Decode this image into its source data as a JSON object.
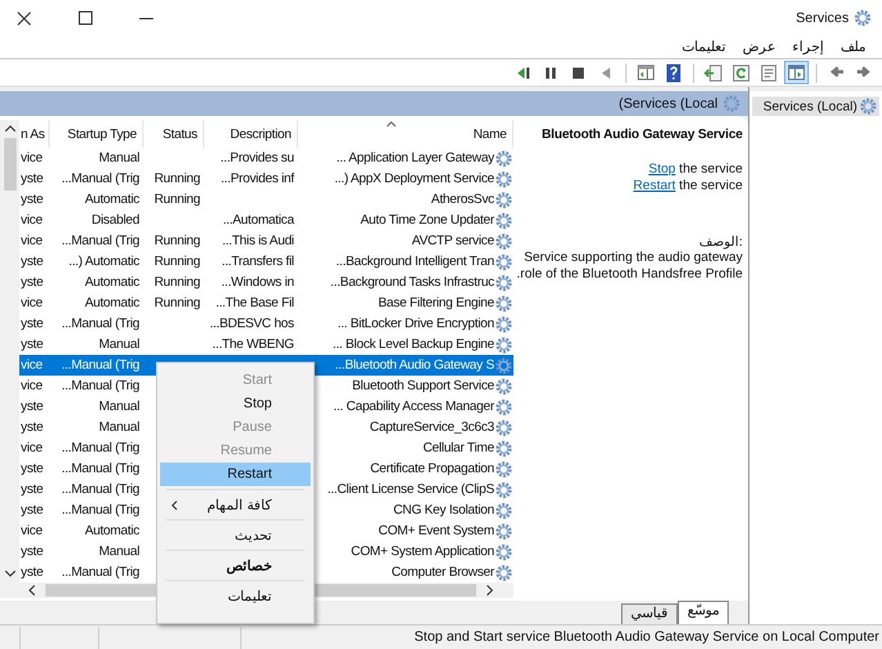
{
  "window": {
    "title": "Services"
  },
  "menu_bar": [
    {
      "label": "ملف"
    },
    {
      "label": "إجراء"
    },
    {
      "label": "عرض"
    },
    {
      "label": "تعليمات"
    }
  ],
  "toolbar": [
    {
      "kind": "forward",
      "pressed": false
    },
    {
      "kind": "back",
      "pressed": false
    },
    {
      "kind": "separator"
    },
    {
      "kind": "tree",
      "pressed": true
    },
    {
      "kind": "properties",
      "pressed": false
    },
    {
      "kind": "refresh",
      "pressed": false
    },
    {
      "kind": "export",
      "pressed": false
    },
    {
      "kind": "separator"
    },
    {
      "kind": "help",
      "pressed": false
    },
    {
      "kind": "pane",
      "pressed": false
    },
    {
      "kind": "separator"
    },
    {
      "kind": "start",
      "pressed": false
    },
    {
      "kind": "stop",
      "pressed": false
    },
    {
      "kind": "pause",
      "pressed": false
    },
    {
      "kind": "restart",
      "pressed": false
    }
  ],
  "panel_header": {
    "title": "(Services (Local"
  },
  "table": {
    "columns": [
      "n As",
      "Startup Type",
      "Status",
      "Description",
      "Name"
    ],
    "rows": [
      {
        "log_on_as": "vice",
        "startup_type": "Manual",
        "description": "...Provides su",
        "name": "... Application Layer Gateway",
        "selected": false
      },
      {
        "log_on_as": "yste",
        "startup_type": "...Manual (Trig",
        "status": "Running",
        "description": "...Provides inf",
        "name": "...) AppX Deployment Service",
        "selected": false
      },
      {
        "log_on_as": "yste",
        "startup_type": "Automatic",
        "status": "Running",
        "name": "AtherosSvc",
        "selected": false
      },
      {
        "log_on_as": "vice",
        "startup_type": "Disabled",
        "description": "...Automatica",
        "name": "Auto Time Zone Updater",
        "selected": false
      },
      {
        "log_on_as": "vice",
        "startup_type": "...Manual (Trig",
        "status": "Running",
        "description": "...This is Audi",
        "name": "AVCTP service",
        "selected": false
      },
      {
        "log_on_as": "yste",
        "startup_type": "...) Automatic",
        "status": "Running",
        "description": "...Transfers fil",
        "name": "...Background Intelligent Tran",
        "selected": false
      },
      {
        "log_on_as": "yste",
        "startup_type": "Automatic",
        "status": "Running",
        "description": "...Windows in",
        "name": "...Background Tasks Infrastruc",
        "selected": false
      },
      {
        "log_on_as": "vice",
        "startup_type": "Automatic",
        "status": "Running",
        "description": "...The Base Fil",
        "name": "Base Filtering Engine",
        "selected": false
      },
      {
        "log_on_as": "yste",
        "startup_type": "...Manual (Trig",
        "description": "...BDESVC hos",
        "name": "... BitLocker Drive Encryption",
        "selected": false
      },
      {
        "log_on_as": "yste",
        "startup_type": "Manual",
        "description": "...The WBENG",
        "name": "... Block Level Backup Engine",
        "selected": false
      },
      {
        "log_on_as": "vice",
        "startup_type": "...Manual (Trig",
        "name": "...Bluetooth Audio Gateway S",
        "selected": true
      },
      {
        "log_on_as": "vice",
        "startup_type": "...Manual (Trig",
        "name": "Bluetooth Support Service",
        "selected": false
      },
      {
        "log_on_as": "yste",
        "startup_type": "Manual",
        "name": "... Capability Access Manager",
        "selected": false
      },
      {
        "log_on_as": "yste",
        "startup_type": "Manual",
        "name": "CaptureService_3c6c3",
        "selected": false
      },
      {
        "log_on_as": "vice",
        "startup_type": "...Manual (Trig",
        "name": "Cellular Time",
        "selected": false
      },
      {
        "log_on_as": "yste",
        "startup_type": "...Manual (Trig",
        "name": "Certificate Propagation",
        "selected": false
      },
      {
        "log_on_as": "yste",
        "startup_type": "...Manual (Trig",
        "name": "...Client License Service (ClipS",
        "selected": false
      },
      {
        "log_on_as": "yste",
        "startup_type": "...Manual (Trig",
        "name": "CNG Key Isolation",
        "selected": false
      },
      {
        "log_on_as": "vice",
        "startup_type": "Automatic",
        "name": "COM+ Event System",
        "selected": false
      },
      {
        "log_on_as": "yste",
        "startup_type": "Manual",
        "name": "COM+ System Application",
        "selected": false
      },
      {
        "log_on_as": "yste",
        "startup_type": "...Manual (Trig",
        "name": "Computer Browser",
        "selected": false
      }
    ]
  },
  "details": {
    "title": "Bluetooth Audio Gateway Service",
    "actions": [
      {
        "link": "Stop",
        "text": " the service"
      },
      {
        "link": "Restart",
        "text": " the service"
      }
    ],
    "description_label": "الوصف:",
    "description": "Service supporting the audio gateway role of the Bluetooth Handsfree Profile."
  },
  "view_tabs": [
    {
      "label": "موسّع",
      "selected": true
    },
    {
      "label": "قياسي",
      "selected": false
    }
  ],
  "tree": {
    "items": [
      {
        "label": "Services (Local)",
        "selected": true
      }
    ]
  },
  "context_menu": [
    {
      "kind": "item",
      "label": "Start",
      "disabled": true,
      "selected": false
    },
    {
      "kind": "item",
      "label": "Stop",
      "disabled": false,
      "selected": false
    },
    {
      "kind": "item",
      "label": "Pause",
      "disabled": true,
      "selected": false
    },
    {
      "kind": "item",
      "label": "Resume",
      "disabled": true,
      "selected": false
    },
    {
      "kind": "item",
      "label": "Restart",
      "disabled": false,
      "selected": true
    },
    {
      "kind": "separator"
    },
    {
      "kind": "submenu",
      "label": "كافة المهام",
      "disabled": false,
      "selected": false
    },
    {
      "kind": "separator"
    },
    {
      "kind": "item",
      "label": "تحديث",
      "disabled": false,
      "selected": false
    },
    {
      "kind": "separator"
    },
    {
      "kind": "default",
      "label": "خصائص",
      "disabled": false,
      "selected": false
    },
    {
      "kind": "separator"
    },
    {
      "kind": "item",
      "label": "تعليمات",
      "disabled": false,
      "selected": false
    }
  ],
  "status_bar": {
    "text": "Stop and Start service Bluetooth Audio Gateway Service on Local Computer"
  }
}
